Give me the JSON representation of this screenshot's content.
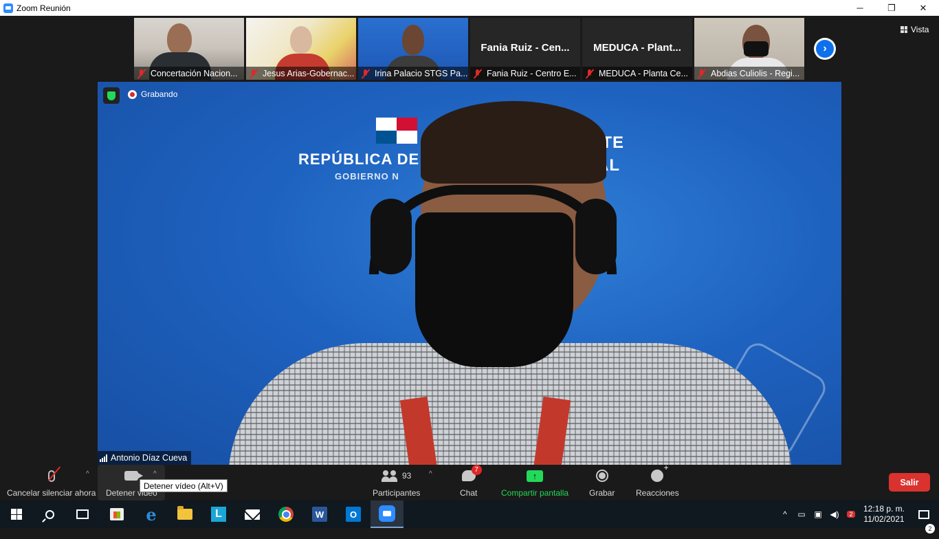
{
  "window": {
    "title": "Zoom Reunión",
    "controls": [
      "minimize",
      "maximize",
      "close"
    ],
    "minimize_glyph": "─",
    "maximize_glyph": "❐",
    "close_glyph": "✕"
  },
  "view": {
    "label": "Vista"
  },
  "thumbnails": [
    {
      "label": "Concertación Nacion...",
      "muted": true,
      "video": true
    },
    {
      "label": "Jesus Arias-Gobernac...",
      "muted": true,
      "video": true
    },
    {
      "label": "Irina Palacio STGS  Pa...",
      "muted": true,
      "video": true
    },
    {
      "name": "Fania Ruiz - Cen...",
      "label": "Fania Ruiz - Centro E...",
      "muted": true,
      "video": false
    },
    {
      "name": "MEDUCA - Plant...",
      "label": "MEDUCA - Planta Ce...",
      "muted": true,
      "video": false
    },
    {
      "label": "Abdias Culiolis - Regi...",
      "muted": true,
      "video": true
    }
  ],
  "main_video": {
    "recording_label": "Grabando",
    "speaker_name": "Antonio Díaz Cueva",
    "background_text": {
      "line1": "REPÚBLICA DE",
      "line2": "BINETE",
      "line3": "CIAL",
      "line4": "GOBIERNO N"
    }
  },
  "toolbar": {
    "mute_label": "Cancelar silenciar ahora",
    "video_label": "Detener video",
    "video_tooltip": "Detener vídeo (Alt+V)",
    "participants_label": "Participantes",
    "participants_count": "93",
    "chat_label": "Chat",
    "chat_badge": "7",
    "share_label": "Compartir pantalla",
    "share_glyph": "↑",
    "record_label": "Grabar",
    "reactions_label": "Reacciones",
    "exit_label": "Salir",
    "caret_glyph": "^"
  },
  "taskbar": {
    "apps": [
      "windows-start",
      "search",
      "task-view",
      "microsoft-store",
      "edge",
      "file-explorer",
      "l-app",
      "mail",
      "chrome",
      "word",
      "outlook",
      "zoom"
    ],
    "edge_glyph": "e",
    "l_glyph": "L",
    "word_glyph": "W",
    "outlook_glyph": "O",
    "tray": {
      "chevron": "^",
      "time": "12:18 p. m.",
      "date": "11/02/2021",
      "notification_count": "2",
      "badge_count": "2"
    }
  },
  "colors": {
    "zoom_blue": "#2d8cff",
    "share_green": "#23d959",
    "exit_red": "#d9322f",
    "mute_red": "#e02828"
  }
}
